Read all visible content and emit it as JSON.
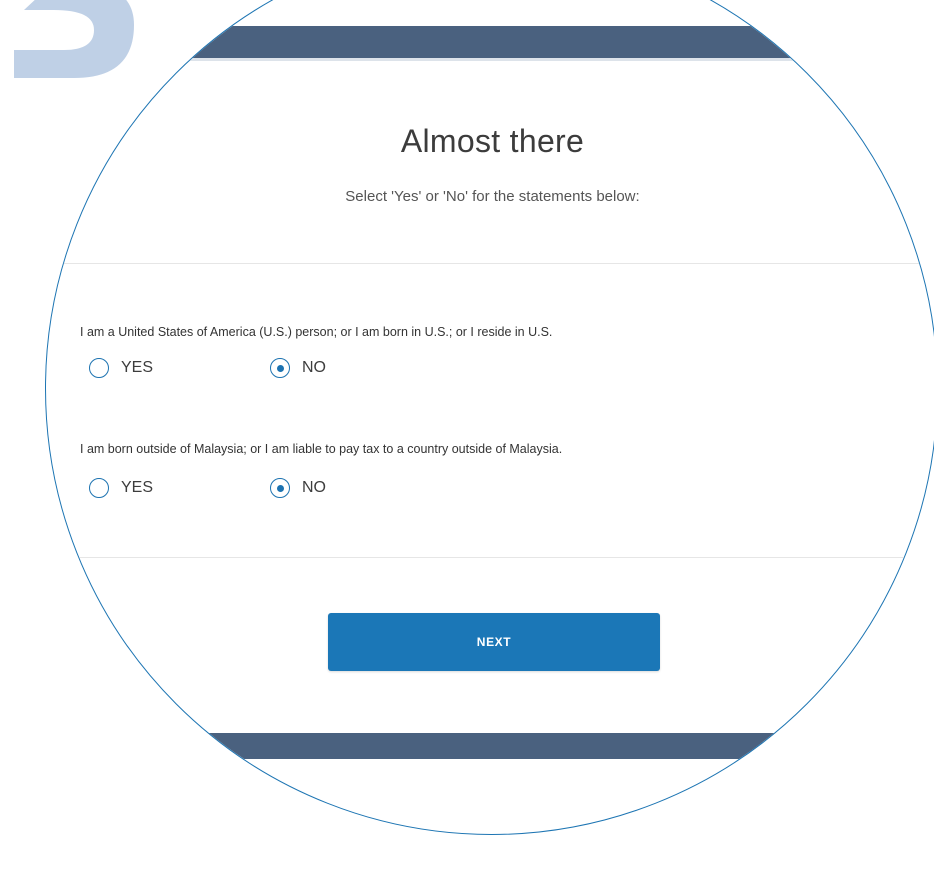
{
  "form": {
    "title": "Almost there",
    "subtitle": "Select 'Yes' or 'No' for the statements below:"
  },
  "questions": [
    {
      "text": "I am a United States of America (U.S.) person; or I am born in U.S.; or I reside in U.S.",
      "options": [
        {
          "label": "YES",
          "selected": false
        },
        {
          "label": "NO",
          "selected": true
        }
      ]
    },
    {
      "text": "I am born outside of Malaysia; or I am liable to pay tax to a country outside of Malaysia.",
      "options": [
        {
          "label": "YES",
          "selected": false
        },
        {
          "label": "NO",
          "selected": true
        }
      ]
    }
  ],
  "actions": {
    "next_label": "NEXT"
  },
  "colors": {
    "accent": "#1b77b7",
    "header_bar": "#4a617f",
    "step_numeral": "#bfd0e6"
  }
}
